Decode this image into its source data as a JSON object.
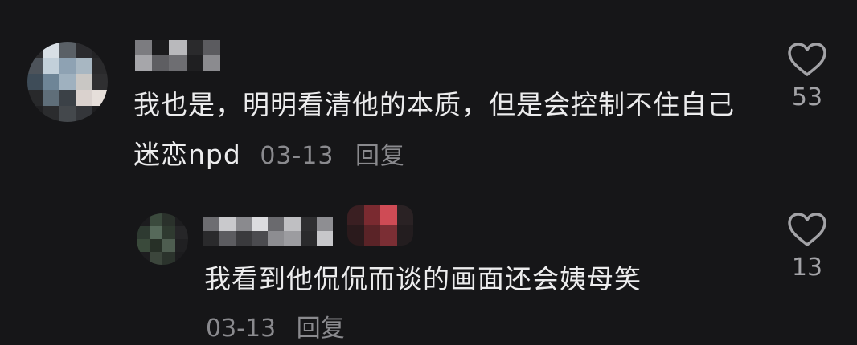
{
  "comments": [
    {
      "text": "我也是，明明看清他的本质，但是会控制不住自己迷恋npd",
      "date": "03-13",
      "reply_label": "回复",
      "like_count": "53",
      "avatar_pixels": [
        "#2a2a2c",
        "#d8dfe5",
        "#5a6066",
        "#2b2b2e",
        "#232325",
        "#4d535a",
        "#c3d0da",
        "#8ea2b3",
        "#a8b7c2",
        "#2a2a2c",
        "#3e4c58",
        "#6e8597",
        "#9fb1bf",
        "#c9c7c4",
        "#2f2f31",
        "#28292b",
        "#5f6e79",
        "#3b4147",
        "#dad2ce",
        "#e6dfda",
        "#202022",
        "#2b2c2e",
        "#44484c",
        "#34363a",
        "#1e1e20"
      ],
      "name_pixels": [
        "#7c7c80",
        "#1b1b1d",
        "#b9b9bc",
        "#2a2a2c",
        "#5b5b5f",
        "#a6a6aa",
        "#5e5e62",
        "#6e6e72",
        "#1f1f21",
        "#8b8b8f"
      ]
    },
    {
      "text": "我看到他侃侃而谈的画面还会姨母笑",
      "date": "03-13",
      "reply_label": "回复",
      "like_count": "13",
      "avatar_pixels": [
        "#1c1c1e",
        "#3b4a3d",
        "#2a312b",
        "#1d1d1f",
        "#2e3a31",
        "#56695a",
        "#2f3a30",
        "#262628",
        "#3a4a3b",
        "#273027",
        "#4e5d50",
        "#202022",
        "#1d1d1f",
        "#3c463c",
        "#2b332c",
        "#1c1c1e"
      ],
      "name_pixels": [
        "#6d6d71",
        "#c9c9cc",
        "#8a8a8e",
        "#dcdcdf",
        "#6a6a6e",
        "#bfbfc2",
        "#2f2f31",
        "#8e8e92",
        "#2a2a2c",
        "#5c5c60",
        "#3a3a3d",
        "#4b4b4f",
        "#8d8d91",
        "#9c9ca0",
        "#2a2a2c",
        "#c7c7ca"
      ],
      "badge_pixels": [
        "#3a1f22",
        "#7a2a30",
        "#cf4b55",
        "#2a2224",
        "#2a1a1c",
        "#5a2327",
        "#7b2e34",
        "#231d1f"
      ]
    }
  ],
  "colors": {
    "background": "#161618",
    "text": "#ececed",
    "meta": "#8a8a8e",
    "heart": "#a3a3a7"
  },
  "icons": {
    "like": "heart-outline-icon"
  }
}
